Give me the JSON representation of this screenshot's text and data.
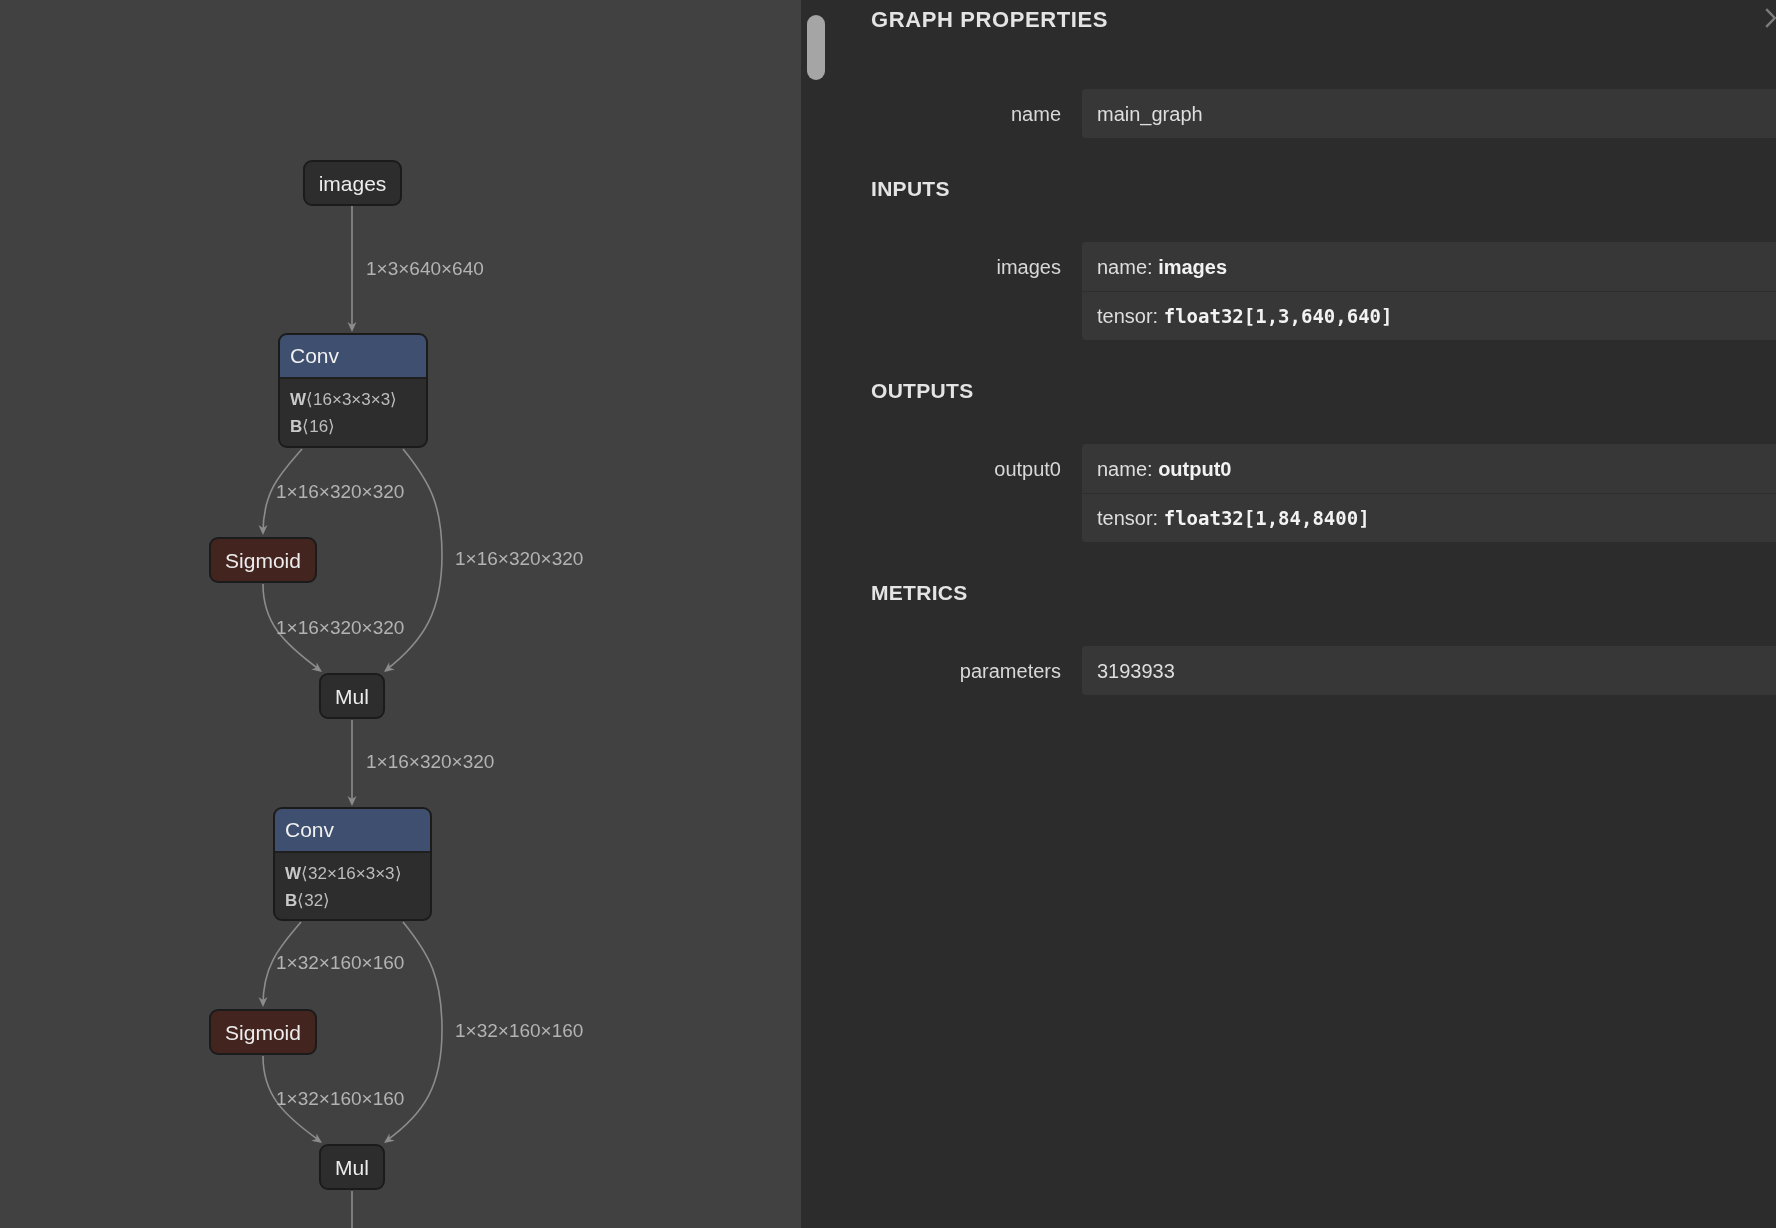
{
  "graph": {
    "nodes": [
      {
        "kind": "simple",
        "label": "images"
      },
      {
        "kind": "block",
        "label": "Conv",
        "color": "#3f4f6f",
        "attributes": [
          {
            "name": "W",
            "value": "⟨16×3×3×3⟩"
          },
          {
            "name": "B",
            "value": "⟨16⟩"
          }
        ]
      },
      {
        "kind": "simple",
        "label": "Sigmoid",
        "color": "#43241f"
      },
      {
        "kind": "simple",
        "label": "Mul"
      },
      {
        "kind": "block",
        "label": "Conv",
        "color": "#3f4f6f",
        "attributes": [
          {
            "name": "W",
            "value": "⟨32×16×3×3⟩"
          },
          {
            "name": "B",
            "value": "⟨32⟩"
          }
        ]
      },
      {
        "kind": "simple",
        "label": "Sigmoid",
        "color": "#43241f"
      },
      {
        "kind": "simple",
        "label": "Mul"
      }
    ],
    "edges": [
      {
        "label": "1×3×640×640"
      },
      {
        "label": "1×16×320×320"
      },
      {
        "label": "1×16×320×320"
      },
      {
        "label": "1×16×320×320"
      },
      {
        "label": "1×16×320×320"
      },
      {
        "label": "1×32×160×160"
      },
      {
        "label": "1×32×160×160"
      },
      {
        "label": "1×32×160×160"
      }
    ]
  },
  "properties": {
    "title": "GRAPH PROPERTIES",
    "sections": [
      {
        "items": [
          {
            "label": "name",
            "fields": [
              {
                "kind": "plain",
                "value": "main_graph"
              }
            ]
          }
        ]
      },
      {
        "title": "INPUTS",
        "items": [
          {
            "label": "images",
            "fields": [
              {
                "kind": "bold",
                "key": "name:",
                "value": "images"
              },
              {
                "kind": "code",
                "key": "tensor:",
                "value": "float32[1,3,640,640]"
              }
            ]
          }
        ]
      },
      {
        "title": "OUTPUTS",
        "items": [
          {
            "label": "output0",
            "fields": [
              {
                "kind": "bold",
                "key": "name:",
                "value": "output0"
              },
              {
                "kind": "code",
                "key": "tensor:",
                "value": "float32[1,84,8400]"
              }
            ]
          }
        ]
      },
      {
        "title": "METRICS",
        "items": [
          {
            "label": "parameters",
            "fields": [
              {
                "kind": "plain",
                "value": "3193933"
              }
            ]
          }
        ]
      }
    ]
  }
}
